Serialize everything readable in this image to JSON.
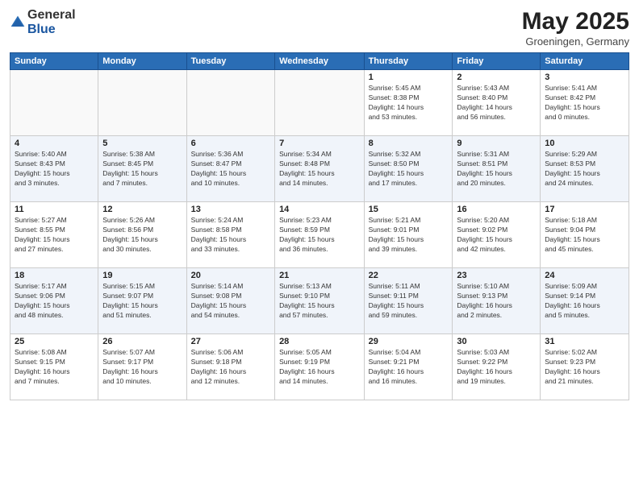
{
  "logo": {
    "general": "General",
    "blue": "Blue"
  },
  "title": "May 2025",
  "subtitle": "Groeningen, Germany",
  "days_header": [
    "Sunday",
    "Monday",
    "Tuesday",
    "Wednesday",
    "Thursday",
    "Friday",
    "Saturday"
  ],
  "weeks": [
    [
      {
        "day": "",
        "info": ""
      },
      {
        "day": "",
        "info": ""
      },
      {
        "day": "",
        "info": ""
      },
      {
        "day": "",
        "info": ""
      },
      {
        "day": "1",
        "info": "Sunrise: 5:45 AM\nSunset: 8:38 PM\nDaylight: 14 hours\nand 53 minutes."
      },
      {
        "day": "2",
        "info": "Sunrise: 5:43 AM\nSunset: 8:40 PM\nDaylight: 14 hours\nand 56 minutes."
      },
      {
        "day": "3",
        "info": "Sunrise: 5:41 AM\nSunset: 8:42 PM\nDaylight: 15 hours\nand 0 minutes."
      }
    ],
    [
      {
        "day": "4",
        "info": "Sunrise: 5:40 AM\nSunset: 8:43 PM\nDaylight: 15 hours\nand 3 minutes."
      },
      {
        "day": "5",
        "info": "Sunrise: 5:38 AM\nSunset: 8:45 PM\nDaylight: 15 hours\nand 7 minutes."
      },
      {
        "day": "6",
        "info": "Sunrise: 5:36 AM\nSunset: 8:47 PM\nDaylight: 15 hours\nand 10 minutes."
      },
      {
        "day": "7",
        "info": "Sunrise: 5:34 AM\nSunset: 8:48 PM\nDaylight: 15 hours\nand 14 minutes."
      },
      {
        "day": "8",
        "info": "Sunrise: 5:32 AM\nSunset: 8:50 PM\nDaylight: 15 hours\nand 17 minutes."
      },
      {
        "day": "9",
        "info": "Sunrise: 5:31 AM\nSunset: 8:51 PM\nDaylight: 15 hours\nand 20 minutes."
      },
      {
        "day": "10",
        "info": "Sunrise: 5:29 AM\nSunset: 8:53 PM\nDaylight: 15 hours\nand 24 minutes."
      }
    ],
    [
      {
        "day": "11",
        "info": "Sunrise: 5:27 AM\nSunset: 8:55 PM\nDaylight: 15 hours\nand 27 minutes."
      },
      {
        "day": "12",
        "info": "Sunrise: 5:26 AM\nSunset: 8:56 PM\nDaylight: 15 hours\nand 30 minutes."
      },
      {
        "day": "13",
        "info": "Sunrise: 5:24 AM\nSunset: 8:58 PM\nDaylight: 15 hours\nand 33 minutes."
      },
      {
        "day": "14",
        "info": "Sunrise: 5:23 AM\nSunset: 8:59 PM\nDaylight: 15 hours\nand 36 minutes."
      },
      {
        "day": "15",
        "info": "Sunrise: 5:21 AM\nSunset: 9:01 PM\nDaylight: 15 hours\nand 39 minutes."
      },
      {
        "day": "16",
        "info": "Sunrise: 5:20 AM\nSunset: 9:02 PM\nDaylight: 15 hours\nand 42 minutes."
      },
      {
        "day": "17",
        "info": "Sunrise: 5:18 AM\nSunset: 9:04 PM\nDaylight: 15 hours\nand 45 minutes."
      }
    ],
    [
      {
        "day": "18",
        "info": "Sunrise: 5:17 AM\nSunset: 9:06 PM\nDaylight: 15 hours\nand 48 minutes."
      },
      {
        "day": "19",
        "info": "Sunrise: 5:15 AM\nSunset: 9:07 PM\nDaylight: 15 hours\nand 51 minutes."
      },
      {
        "day": "20",
        "info": "Sunrise: 5:14 AM\nSunset: 9:08 PM\nDaylight: 15 hours\nand 54 minutes."
      },
      {
        "day": "21",
        "info": "Sunrise: 5:13 AM\nSunset: 9:10 PM\nDaylight: 15 hours\nand 57 minutes."
      },
      {
        "day": "22",
        "info": "Sunrise: 5:11 AM\nSunset: 9:11 PM\nDaylight: 15 hours\nand 59 minutes."
      },
      {
        "day": "23",
        "info": "Sunrise: 5:10 AM\nSunset: 9:13 PM\nDaylight: 16 hours\nand 2 minutes."
      },
      {
        "day": "24",
        "info": "Sunrise: 5:09 AM\nSunset: 9:14 PM\nDaylight: 16 hours\nand 5 minutes."
      }
    ],
    [
      {
        "day": "25",
        "info": "Sunrise: 5:08 AM\nSunset: 9:15 PM\nDaylight: 16 hours\nand 7 minutes."
      },
      {
        "day": "26",
        "info": "Sunrise: 5:07 AM\nSunset: 9:17 PM\nDaylight: 16 hours\nand 10 minutes."
      },
      {
        "day": "27",
        "info": "Sunrise: 5:06 AM\nSunset: 9:18 PM\nDaylight: 16 hours\nand 12 minutes."
      },
      {
        "day": "28",
        "info": "Sunrise: 5:05 AM\nSunset: 9:19 PM\nDaylight: 16 hours\nand 14 minutes."
      },
      {
        "day": "29",
        "info": "Sunrise: 5:04 AM\nSunset: 9:21 PM\nDaylight: 16 hours\nand 16 minutes."
      },
      {
        "day": "30",
        "info": "Sunrise: 5:03 AM\nSunset: 9:22 PM\nDaylight: 16 hours\nand 19 minutes."
      },
      {
        "day": "31",
        "info": "Sunrise: 5:02 AM\nSunset: 9:23 PM\nDaylight: 16 hours\nand 21 minutes."
      }
    ]
  ]
}
